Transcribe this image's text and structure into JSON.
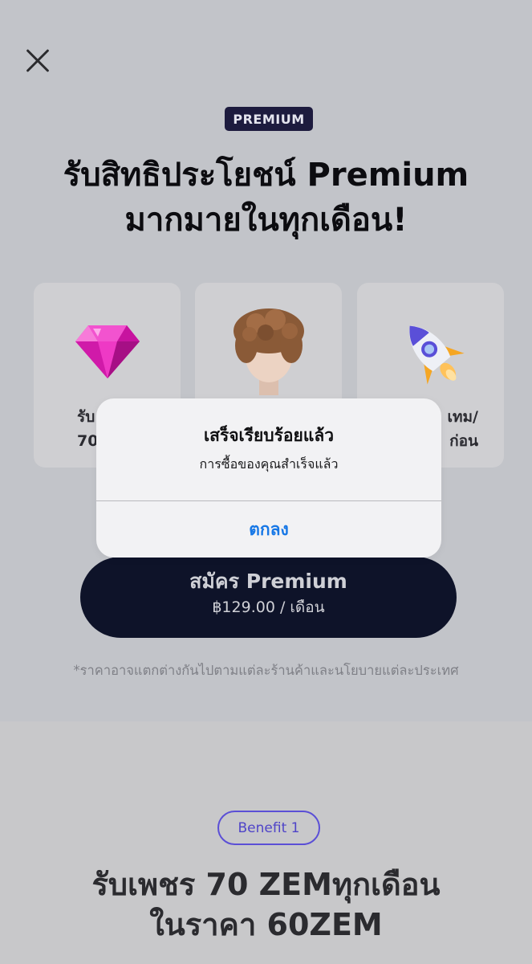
{
  "header": {
    "badge": "PREMIUM",
    "headline_line1": "รับสิทธิประโยชน์ Premium",
    "headline_line2": "มากมายในทุกเดือน!"
  },
  "cards": [
    {
      "icon": "gem-icon",
      "label_line1": "รับ",
      "label_line2": "70"
    },
    {
      "icon": "avatar-icon"
    },
    {
      "icon": "rocket-icon",
      "label_line1": "เทม/",
      "label_line2": "ก่อน"
    }
  ],
  "cta": {
    "title": "สมัคร Premium",
    "price": "฿129.00 / เดือน"
  },
  "disclaimer": "*ราคาอาจแตกต่างกันไปตามแต่ละร้านค้าและนโยบายแต่ละประเทศ",
  "benefit": {
    "badge": "Benefit 1",
    "title_line1": "รับเพชร 70 ZEMทุกเดือน",
    "title_line2": "ในราคา 60ZEM"
  },
  "dialog": {
    "title": "เสร็จเรียบร้อยแล้ว",
    "message": "การซื้อของคุณสำเร็จแล้ว",
    "ok_label": "ตกลง"
  },
  "colors": {
    "overlay_background": "#c2c4c9",
    "badge_background": "#1d1b3e",
    "cta_background": "#0e1329",
    "benefit_accent": "#5b4fd6",
    "dialog_button": "#1677e6"
  }
}
